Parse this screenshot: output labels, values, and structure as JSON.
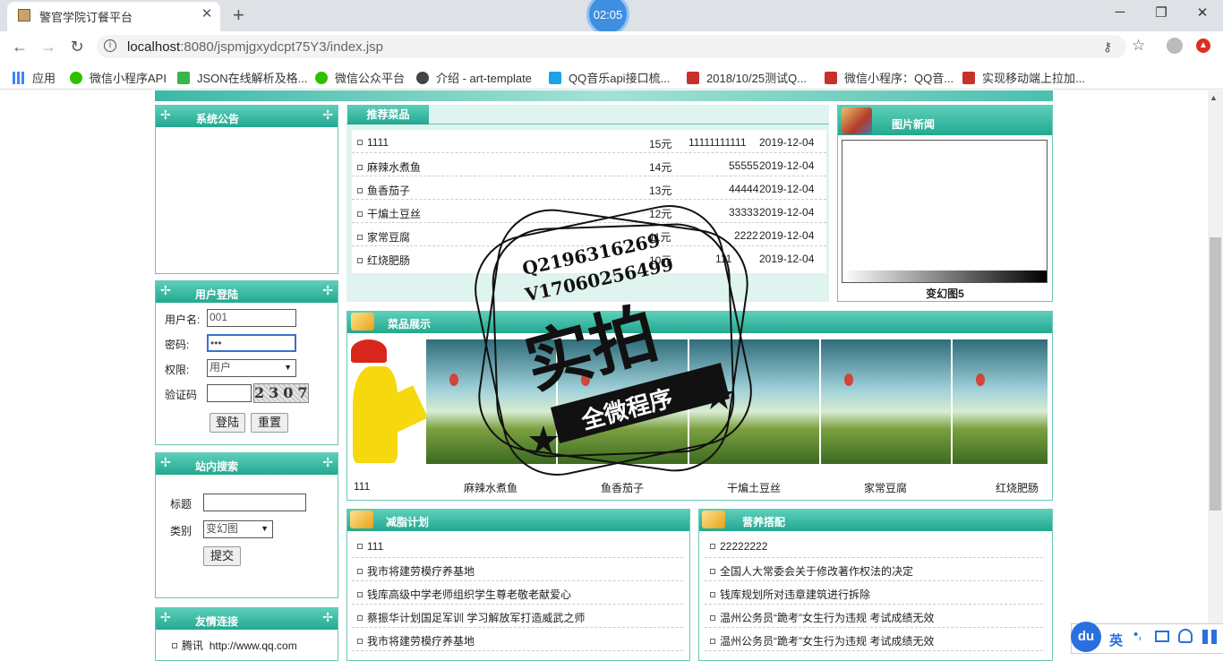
{
  "browser": {
    "tab_title": "警官学院订餐平台",
    "timer": "02:05",
    "url_host": "localhost",
    "url_path": ":8080/jspmjgxydcpt75Y3/index.jsp",
    "bookmarks": [
      "应用",
      "微信小程序API",
      "JSON在线解析及格...",
      "微信公众平台",
      "介绍 - art-template",
      "QQ音乐api接口梳...",
      "2018/10/25测试Q...",
      "微信小程序：QQ音...",
      "实现移动端上拉加..."
    ]
  },
  "notice": {
    "title": "系统公告"
  },
  "login": {
    "title": "用户登陆",
    "username_label": "用户名:",
    "username_value": "001",
    "password_label": "密码:",
    "password_value": "•••",
    "role_label": "权限:",
    "role_value": "用户",
    "captcha_label": "验证码",
    "captcha_value": "2307",
    "login_button": "登陆",
    "reset_button": "重置"
  },
  "search": {
    "title": "站内搜索",
    "title_label": "标题",
    "category_label": "类别",
    "category_value": "变幻图",
    "submit_button": "提交"
  },
  "links": {
    "title": "友情连接",
    "items": [
      {
        "name": "腾讯",
        "url": "http://www.qq.com"
      }
    ]
  },
  "recommended": {
    "tab": "推荐菜品",
    "rows": [
      {
        "name": "1111",
        "price": "15元",
        "code": "11111111111",
        "date": "2019-12-04"
      },
      {
        "name": "麻辣水煮鱼",
        "price": "14元",
        "code": "55555",
        "date": "2019-12-04"
      },
      {
        "name": "鱼香茄子",
        "price": "13元",
        "code": "44444",
        "date": "2019-12-04"
      },
      {
        "name": "干煸土豆丝",
        "price": "12元",
        "code": "33333",
        "date": "2019-12-04"
      },
      {
        "name": "家常豆腐",
        "price": "11元",
        "code": "2222",
        "date": "2019-12-04"
      },
      {
        "name": "红烧肥肠",
        "price": "10元",
        "code": "111",
        "date": "2019-12-04"
      }
    ]
  },
  "news": {
    "title": "图片新闻",
    "caption": "变幻图5"
  },
  "showcase": {
    "title": "菜品展示",
    "captions": [
      "111",
      "麻辣水煮鱼",
      "鱼香茄子",
      "干煸土豆丝",
      "家常豆腐",
      "红烧肥肠"
    ]
  },
  "diet": {
    "title": "减脂计划",
    "items": [
      "111",
      "我市将建劳模疗养基地",
      "钱库高级中学老师组织学生尊老敬老献爱心",
      "蔡振华计划国足军训 学习解放军打造威武之师",
      "我市将建劳模疗养基地"
    ]
  },
  "nutrition": {
    "title": "营养搭配",
    "items": [
      "22222222",
      "全国人大常委会关于修改著作权法的决定",
      "钱库规划所对违章建筑进行拆除",
      "温州公务员“跪考”女生行为违规 考试成绩无效",
      "温州公务员“跪考”女生行为违规 考试成绩无效"
    ]
  },
  "watermark": {
    "line1": "Q2196316269",
    "line2": "V17060256499",
    "big": "实拍",
    "ribbon": "全微程序"
  },
  "ime": {
    "lang": "英"
  }
}
